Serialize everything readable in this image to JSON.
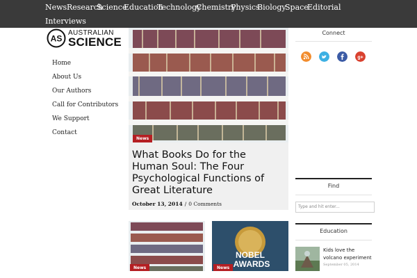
{
  "top_nav": [
    "News",
    "Research",
    "Science",
    "Education",
    "Technology",
    "Chemistry",
    "Physics",
    "Biology",
    "Space",
    "Editorial",
    "Interviews"
  ],
  "logo": {
    "mark": "AS",
    "line1": "AUSTRALIAN",
    "line2": "SCIENCE"
  },
  "side_nav": [
    "Home",
    "About Us",
    "Our Authors",
    "Call for Contributors",
    "We Support",
    "Contact"
  ],
  "feature": {
    "tag": "News",
    "title": "What Books Do for the Human Soul: The Four Psychological Functions of Great Literature",
    "date": "October 13, 2014",
    "separator": "/",
    "comments": "0 Comments"
  },
  "thumbs": [
    {
      "tag": "News"
    },
    {
      "tag": "News",
      "overlay_line1": "NOBEL",
      "overlay_line2": "AWARDS"
    }
  ],
  "sidebar": {
    "connect_title": "Connect",
    "social_icons": [
      {
        "name": "rss-icon",
        "color": "#f28c2d"
      },
      {
        "name": "twitter-icon",
        "color": "#3db0e3"
      },
      {
        "name": "facebook-icon",
        "color": "#3b5ba5"
      },
      {
        "name": "google-plus-icon",
        "color": "#d9412f"
      }
    ],
    "find_title": "Find",
    "search_placeholder": "Type and hit enter...",
    "education_title": "Education",
    "education_post": {
      "title": "Kids love the volcano experiment",
      "date": "September 05, 2014"
    }
  },
  "colors": {
    "topbar": "#3a3a3a",
    "tag": "#b51e22",
    "feature_bg": "#f0f0f0"
  }
}
